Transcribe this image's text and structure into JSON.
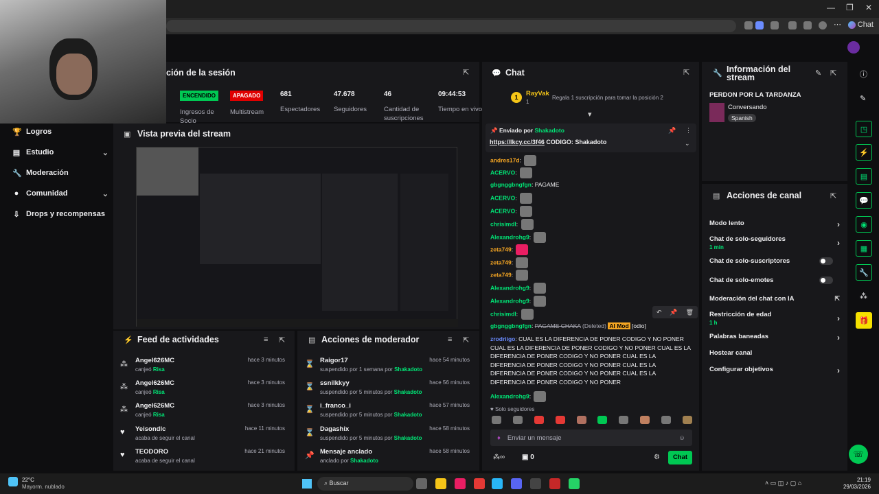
{
  "browser": {
    "chat_label": "Chat"
  },
  "session": {
    "title": "ción de la sesión",
    "stats": [
      {
        "value": "ENCENDIDO",
        "label": "Ingresos de Socio"
      },
      {
        "value": "APAGADO",
        "label": "Multistream"
      },
      {
        "value": "681",
        "label": "Espectadores"
      },
      {
        "value": "47.678",
        "label": "Seguidores"
      },
      {
        "value": "46",
        "label": "Cantidad de suscripciones"
      },
      {
        "value": "09:44:53",
        "label": "Tiempo en vivo"
      }
    ]
  },
  "sidebar": {
    "items": [
      "Logros",
      "Estudio",
      "Moderación",
      "Comunidad",
      "Drops y recompensas"
    ]
  },
  "preview": {
    "title": "Vista previa del stream"
  },
  "activity": {
    "title": "Feed de actividades",
    "rows": [
      {
        "name": "Angel626MC",
        "sub": "canjeó",
        "reward": "Risa",
        "time": "hace 3 minutos"
      },
      {
        "name": "Angel626MC",
        "sub": "canjeó",
        "reward": "Risa",
        "time": "hace 3 minutos"
      },
      {
        "name": "Angel626MC",
        "sub": "canjeó",
        "reward": "Risa",
        "time": "hace 3 minutos"
      },
      {
        "name": "Yeisondlc",
        "sub": "acaba de seguir el canal",
        "reward": "",
        "time": "hace 11 minutos"
      },
      {
        "name": "TEODORO",
        "sub": "acaba de seguir el canal",
        "reward": "",
        "time": "hace 21 minutos"
      }
    ]
  },
  "modactions": {
    "title": "Acciones de moderador",
    "rows": [
      {
        "name": "Raigor17",
        "sub": "suspendido por 1 semana por",
        "by": "Shakadoto",
        "time": "hace 54 minutos"
      },
      {
        "name": "ssnilkkyy",
        "sub": "suspendido por 5 minutos por",
        "by": "Shakadoto",
        "time": "hace 56 minutos"
      },
      {
        "name": "i_franco_i",
        "sub": "suspendido por 5 minutos por",
        "by": "Shakadoto",
        "time": "hace 57 minutos"
      },
      {
        "name": "Dagashix",
        "sub": "suspendido por 5 minutos por",
        "by": "Shakadoto",
        "time": "hace 58 minutos"
      },
      {
        "name": "Mensaje anclado",
        "sub": "anclado por",
        "by": "Shakadoto",
        "time": "hace 58 minutos"
      }
    ]
  },
  "chat": {
    "title": "Chat",
    "top_user": "RayVak",
    "top_rank": "1",
    "top_count": "1",
    "gift_text": "Regala 1 suscripción para tomar la posición 2",
    "pinned_label": "Enviado por",
    "pinned_user": "Shakadoto",
    "pinned_link": "https://lkcy.cc/3f46",
    "pinned_text": "CODIGO: Shakadoto",
    "messages": [
      {
        "user": "andres17d",
        "color": "#f5a623",
        "text": ""
      },
      {
        "user": "ACERVO",
        "color": "#00e676",
        "text": ""
      },
      {
        "user": "gbgnggbngfgn",
        "color": "#00e676",
        "text": "PAGAME"
      },
      {
        "user": "ACERVO",
        "color": "#00e676",
        "text": ""
      },
      {
        "user": "ACERVO",
        "color": "#00e676",
        "text": ""
      },
      {
        "user": "chrisimdl",
        "color": "#00e676",
        "text": ""
      },
      {
        "user": "Alexandrohg9",
        "color": "#00e676",
        "text": ""
      },
      {
        "user": "zeta749",
        "color": "#f5a623",
        "text": ""
      },
      {
        "user": "zeta749",
        "color": "#f5a623",
        "text": ""
      },
      {
        "user": "zeta749",
        "color": "#f5a623",
        "text": ""
      },
      {
        "user": "Alexandrohg9",
        "color": "#00e676",
        "text": ""
      },
      {
        "user": "Alexandrohg9",
        "color": "#00e676",
        "text": ""
      },
      {
        "user": "chrisimdl",
        "color": "#00e676",
        "text": ""
      }
    ],
    "deleted_user": "gbgnggbngfgn",
    "deleted_text": "PAGAME CHAKA",
    "deleted_tag": "(Deleted)",
    "ai_tag": "AI Mod",
    "odio_tag": "[odio]",
    "long_user": "zrodriigo",
    "long_text": "CUAL ES LA DIFERENCIA DE PONER CODIGO Y NO PONER CUAL ES LA DIFERENCIA DE PONER CODIGO Y NO PONER CUAL ES LA DIFERENCIA DE PONER CODIGO Y NO PONER CUAL ES LA DIFERENCIA DE PONER CODIGO Y NO PONER CUAL ES LA DIFERENCIA DE PONER CODIGO Y NO PONER CUAL ES LA DIFERENCIA DE PONER CODIGO Y NO PONER",
    "last_user": "Alexandrohg9",
    "followers_only": "Solo seguidores",
    "input_placeholder": "Enviar un mensaje",
    "points": "0",
    "send_label": "Chat"
  },
  "streaminfo": {
    "title": "Información del stream",
    "stream_title": "PERDON POR LA TARDANZA",
    "category": "Conversando",
    "language": "Spanish"
  },
  "channel": {
    "title": "Acciones de canal",
    "items": [
      {
        "label": "Modo lento",
        "sub": "",
        "kind": "chev"
      },
      {
        "label": "Chat de solo-seguidores",
        "sub": "1 min",
        "kind": "chev"
      },
      {
        "label": "Chat de solo-suscriptores",
        "sub": "",
        "kind": "toggle"
      },
      {
        "label": "Chat de solo-emotes",
        "sub": "",
        "kind": "toggle"
      },
      {
        "label": "Moderación del chat con IA",
        "sub": "",
        "kind": "ext"
      },
      {
        "label": "Restricción de edad",
        "sub": "1 h",
        "kind": "chev"
      },
      {
        "label": "Palabras baneadas",
        "sub": "",
        "kind": "chev"
      },
      {
        "label": "Hostear canal",
        "sub": "",
        "kind": "none"
      },
      {
        "label": "Configurar objetivos",
        "sub": "",
        "kind": "chev"
      }
    ]
  },
  "taskbar": {
    "temp": "22°C",
    "weather": "Mayorm. nublado",
    "search": "Buscar",
    "time": "21:19",
    "date": "29/03/2026"
  }
}
